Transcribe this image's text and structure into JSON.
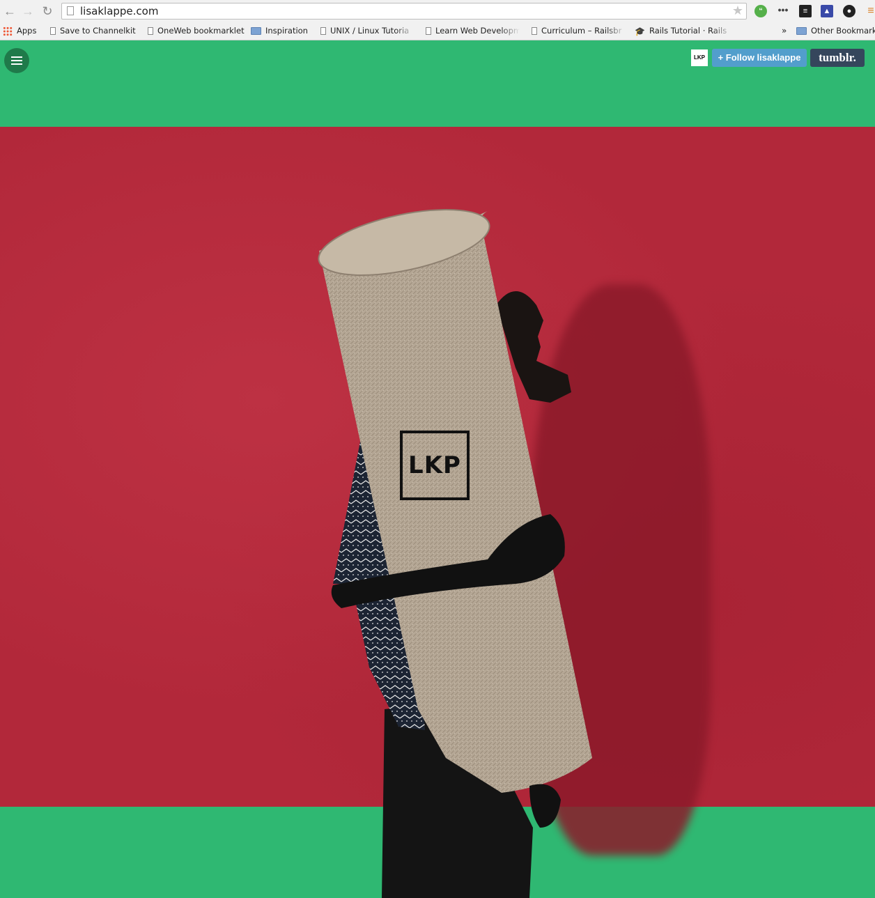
{
  "browser": {
    "url": "lisaklappe.com",
    "bookmarks": [
      {
        "label": "Apps",
        "icon": "apps-grid-icon"
      },
      {
        "label": "Save to Channelkit",
        "icon": "page-icon"
      },
      {
        "label": "OneWeb bookmarklet",
        "icon": "page-icon"
      },
      {
        "label": "Inspiration",
        "icon": "folder-icon"
      },
      {
        "label": "UNIX / Linux Tutoria",
        "icon": "page-icon"
      },
      {
        "label": "Learn Web Developm",
        "icon": "page-icon"
      },
      {
        "label": "Curriculum – Railsbr",
        "icon": "page-icon"
      },
      {
        "label": "Rails Tutorial · Rails",
        "icon": "mortarboard-icon"
      }
    ],
    "overflow": "»",
    "other_bookmarks": "Other Bookmarks"
  },
  "page": {
    "logo_small": "LKP",
    "follow_label": "+ Follow lisaklappe",
    "tumblr_label": "tumblr.",
    "logo_main": "LKP"
  },
  "colors": {
    "green": "#2fb872",
    "red": "#b2283a",
    "follow_blue": "#529ecc",
    "tumblr_navy": "#35465c"
  }
}
